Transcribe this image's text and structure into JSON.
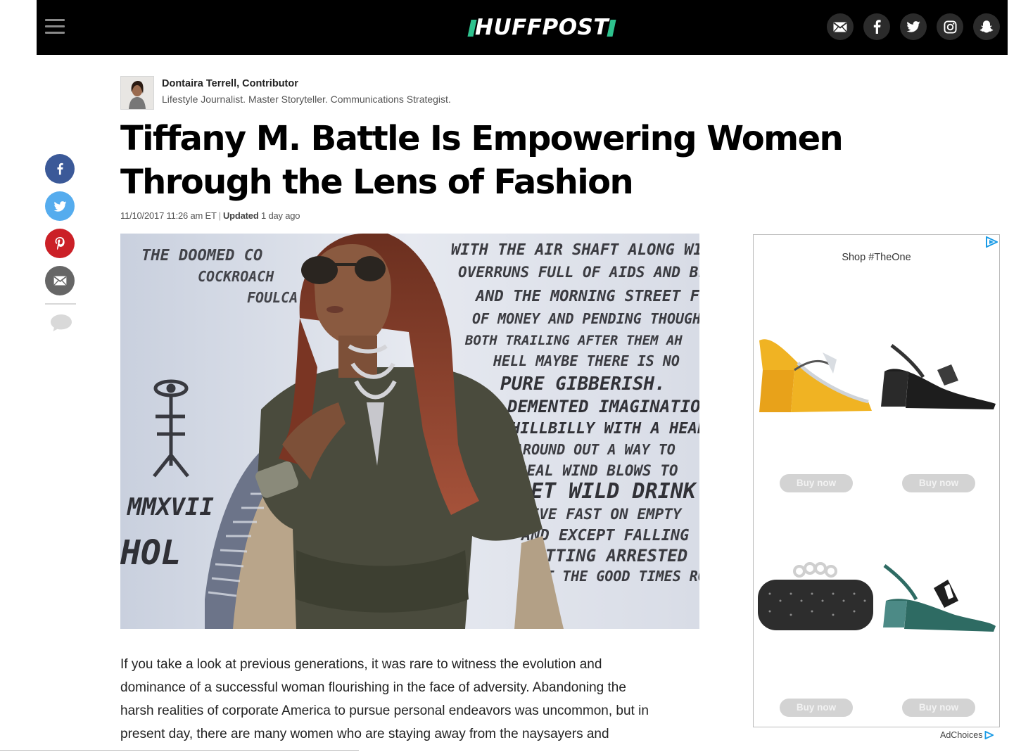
{
  "header": {
    "logo_text": "HUFFPOST",
    "logo_accent": "#2ec28e",
    "menu_icon": "hamburger-icon",
    "social_icons": [
      "mail-icon",
      "facebook-icon",
      "twitter-icon",
      "instagram-icon",
      "snapchat-icon"
    ]
  },
  "author": {
    "name": "Dontaira Terrell, Contributor",
    "bio": "Lifestyle Journalist. Master Storyteller. Communications Strategist."
  },
  "article": {
    "headline_line1": "Tiffany M. Battle Is Empowering Women",
    "headline_line2": "Through the Lens of Fashion",
    "published": "11/10/2017 11:26 am ET",
    "separator": "|",
    "updated_label": "Updated",
    "updated_value": "1 day ago",
    "body_line1": "If you take a look at previous generations, it was rare to witness the evolution and",
    "body_line2": "dominance of a successful woman flourishing in the face of adversity. Abandoning the",
    "body_line3": "harsh realities of corporate America to pursue personal endeavors was uncommon, but in",
    "body_line4": "present day, there are many women who are staying away from the naysayers and"
  },
  "hero_wall_text": [
    "THE DOOMED CO",
    "COCKROACH",
    "FOULCA",
    "WITH THE AIR SHAFT ALONG WITH",
    "OVERRUNS FULL OF AIDS AND BLUR",
    "AND THE MORNING STREET FULL",
    "OF MONEY AND PENDING THOUGHTS",
    "BOTH TRAILING AFTER THEM AH",
    "HELL MAYBE THERE IS NO",
    "PURE GIBBERISH.",
    "DEMENTED IMAGINATION",
    "HILLBILLY WITH A HEART",
    "AROUND OUT A WAY TO",
    "REAL WIND BLOWS TO",
    "LET WILD DRINK",
    "LIVE FAST ON EMPTY",
    "AND EXCEPT FALLING",
    "GETTING ARRESTED",
    "LET THE GOOD TIMES ROLL",
    "MMXVII",
    "HOL"
  ],
  "share": {
    "icons": [
      "facebook-icon",
      "twitter-icon",
      "pinterest-icon",
      "email-icon",
      "comment-icon"
    ],
    "colors": {
      "facebook": "#3b5998",
      "twitter": "#55acee",
      "pinterest": "#cb2027",
      "email": "#666666"
    }
  },
  "ad": {
    "title": "Shop #TheOne",
    "info_icon": "ad-info-triangle-icon",
    "items": [
      {
        "name": "yellow-pump",
        "cta": "Buy now"
      },
      {
        "name": "black-slingback",
        "cta": "Buy now"
      },
      {
        "name": "studded-clutch",
        "cta": "Buy now"
      },
      {
        "name": "green-slingback",
        "cta": "Buy now"
      }
    ],
    "adchoices": "AdChoices"
  }
}
